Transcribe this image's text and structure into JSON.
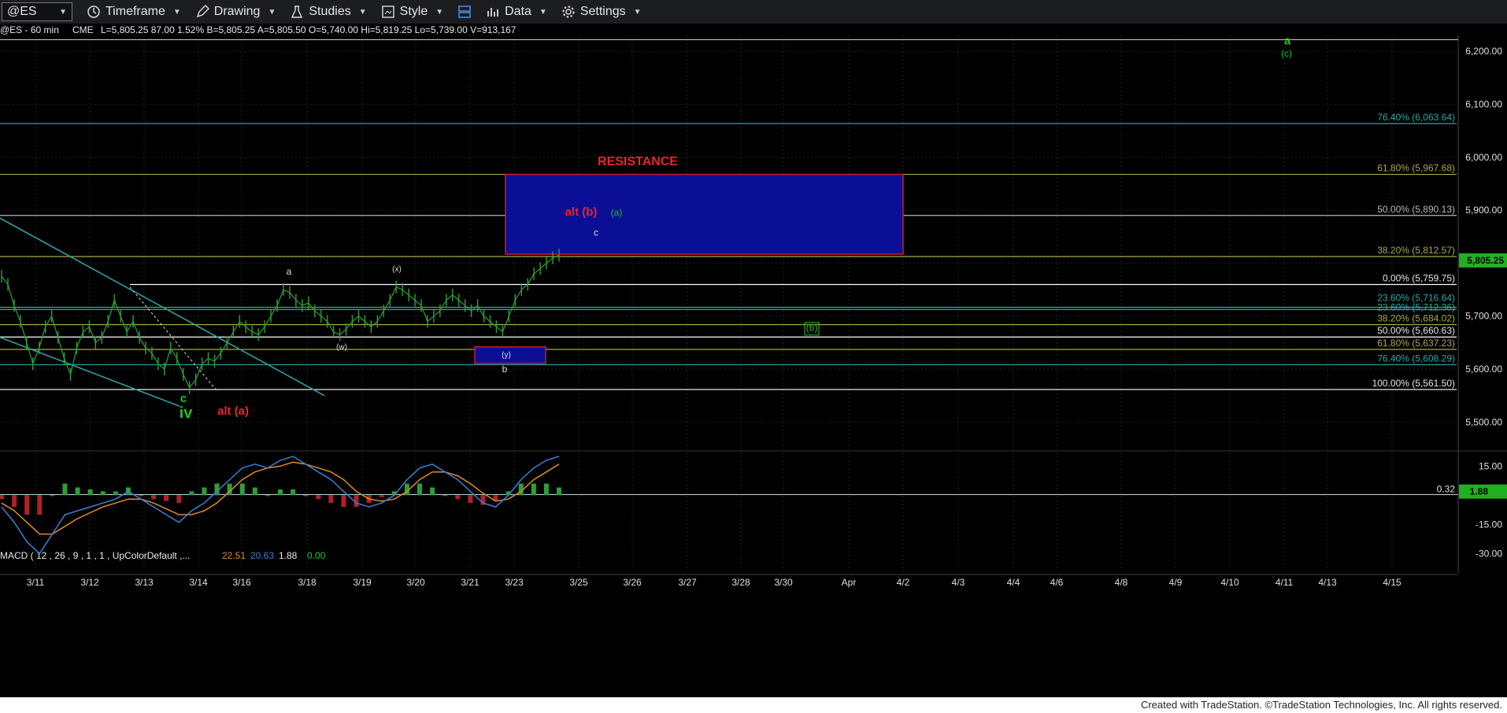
{
  "toolbar": {
    "symbol": "@ES",
    "timeframe": "Timeframe",
    "drawing": "Drawing",
    "studies": "Studies",
    "style": "Style",
    "data": "Data",
    "settings": "Settings"
  },
  "header": {
    "symbol": "@ES - 60 min",
    "exchange": "CME",
    "quote": "L=5,805.25  87.00   1.52%  B=5,805.25  A=5,805.50  O=5,740.00  Hi=5,819.25  Lo=5,739.00  V=913,167"
  },
  "footer": "Created with TradeStation. ©TradeStation Technologies, Inc. All rights reserved.",
  "colors": {
    "price_bar": "#2e9e3a",
    "resistance_box": "#0b0f96",
    "resistance_border": "#d01a2a",
    "label_red": "#e8242a",
    "label_green": "#21c321",
    "fib_olive": "#a9a84a",
    "fib_teal": "#2aa7a7",
    "macd_line": "#3a7fd8",
    "signal_line": "#e08a2a"
  },
  "chart_data": [
    {
      "type": "line",
      "title": "@ES - 60 min",
      "x_ticks": [
        "3/11",
        "3/12",
        "3/13",
        "3/14",
        "3/16",
        "3/18",
        "3/19",
        "3/20",
        "3/21",
        "3/23",
        "3/25",
        "3/26",
        "3/27",
        "3/28",
        "3/30",
        "Apr",
        "4/2",
        "4/3",
        "4/4",
        "4/6",
        "4/8",
        "4/9",
        "4/10",
        "4/11",
        "4/13",
        "4/15"
      ],
      "ylim": [
        5450,
        6230
      ],
      "y_ticks": [
        "6,200.00",
        "6,100.00",
        "6,000.00",
        "5,900.00",
        "5,800.00",
        "5,700.00",
        "5,600.00",
        "5,500.00"
      ],
      "last_price": "5,805.25",
      "series": [
        {
          "values": [
            5775,
            5760,
            5720,
            5690,
            5650,
            5610,
            5640,
            5680,
            5700,
            5660,
            5620,
            5590,
            5640,
            5670,
            5680,
            5650,
            5660,
            5690,
            5730,
            5700,
            5670,
            5690,
            5660,
            5640,
            5630,
            5610,
            5600,
            5640,
            5620,
            5590,
            5565,
            5580,
            5610,
            5620,
            5615,
            5630,
            5650,
            5670,
            5690,
            5680,
            5670,
            5665,
            5680,
            5700,
            5720,
            5750,
            5745,
            5730,
            5720,
            5725,
            5710,
            5700,
            5690,
            5670,
            5665,
            5675,
            5690,
            5700,
            5690,
            5680,
            5690,
            5710,
            5730,
            5755,
            5750,
            5740,
            5730,
            5720,
            5690,
            5700,
            5710,
            5730,
            5740,
            5730,
            5720,
            5710,
            5720,
            5700,
            5690,
            5680,
            5670,
            5700,
            5730,
            5750,
            5760,
            5780,
            5790,
            5800,
            5810,
            5815
          ]
        }
      ],
      "fib_levels": [
        {
          "label": "76.40% (6,063.64)",
          "value": 6063.64
        },
        {
          "label": "61.80% (5,967.68)",
          "value": 5967.68
        },
        {
          "label": "50.00% (5,890.13)",
          "value": 5890.13
        },
        {
          "label": "38.20% (5,812.57)",
          "value": 5812.57
        },
        {
          "label": "0.00% (5,759.75)",
          "value": 5759.75
        },
        {
          "label": "23.60% (5,716.64)",
          "value": 5716.64
        },
        {
          "label": "23.60% (5,712.36)",
          "value": 5712.36
        },
        {
          "label": "38.20% (5,684.02)",
          "value": 5684.02
        },
        {
          "label": "50.00% (5,660.63)",
          "value": 5660.63
        },
        {
          "label": "61.80% (5,637.23)",
          "value": 5637.23
        },
        {
          "label": "76.40% (5,608.29)",
          "value": 5608.29
        },
        {
          "label": "100.00% (5,561.50)",
          "value": 5561.5
        }
      ],
      "annotations": {
        "resistance": "RESISTANCE",
        "alt_b": "alt (b)",
        "a_paren": "(a)",
        "c_wave": "c",
        "a_wave": "a",
        "x_wave": "(x)",
        "w_wave": "(w)",
        "y_wave": "(y)",
        "b_wave": "b",
        "b_box": "(b)",
        "c_low": "c",
        "iv": "iv",
        "alt_a": "alt (a)",
        "top_a": "a",
        "top_c": "(c)"
      }
    },
    {
      "type": "bar",
      "title": "MACD ( 12 , 26 , 9 , 1 , 1 , UpColorDefault ,...",
      "readouts": [
        "22.51",
        "20.63",
        "1.88",
        "0.00"
      ],
      "ylim": [
        -40,
        22
      ],
      "y_ticks": [
        "15.00",
        "0.32",
        "-15.00",
        "-30.00"
      ],
      "last_value": "1.88",
      "macd": [
        -6,
        -14,
        -24,
        -30,
        -20,
        -10,
        -8,
        -6,
        -4,
        -2,
        2,
        -2,
        -6,
        -10,
        -14,
        -8,
        -4,
        2,
        8,
        14,
        16,
        14,
        18,
        20,
        16,
        12,
        8,
        2,
        -4,
        -6,
        -4,
        0,
        8,
        14,
        16,
        12,
        8,
        2,
        -4,
        -6,
        0,
        8,
        14,
        18,
        20
      ],
      "signal": [
        -4,
        -8,
        -14,
        -20,
        -20,
        -16,
        -12,
        -9,
        -6,
        -4,
        -2,
        -2,
        -4,
        -7,
        -10,
        -10,
        -8,
        -4,
        2,
        8,
        12,
        14,
        15,
        17,
        16,
        14,
        12,
        8,
        2,
        -2,
        -3,
        -2,
        2,
        8,
        12,
        12,
        10,
        6,
        1,
        -3,
        -2,
        2,
        8,
        12,
        16
      ],
      "histogram": [
        -2,
        -6,
        -10,
        -10,
        0,
        6,
        4,
        3,
        2,
        2,
        4,
        0,
        -2,
        -3,
        -4,
        2,
        4,
        6,
        6,
        6,
        4,
        0,
        3,
        3,
        0,
        -2,
        -4,
        -6,
        -6,
        -4,
        -1,
        2,
        6,
        6,
        4,
        0,
        -2,
        -4,
        -5,
        -3,
        2,
        6,
        6,
        6,
        4
      ]
    }
  ]
}
